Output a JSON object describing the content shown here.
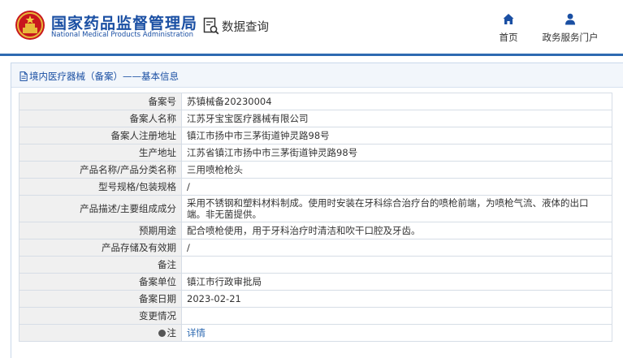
{
  "header": {
    "title": "国家药品监督管理局",
    "subtitle": "National Medical Products Administration",
    "data_query": "数据查询",
    "nav": [
      {
        "label": "首页",
        "icon": "home-icon"
      },
      {
        "label": "政务服务门户",
        "icon": "user-icon"
      }
    ]
  },
  "breadcrumb": {
    "text": "境内医疗器械（备案）——基本信息",
    "icon": "document-icon"
  },
  "colors": {
    "brand_blue": "#1a4fa3",
    "bar_blue": "#2e6ab1",
    "label_bg": "#f0f0f0",
    "panel_head_bg": "#f2f6fb"
  },
  "details": {
    "record_no": {
      "label": "备案号",
      "value": "苏镇械备20230004"
    },
    "registrant": {
      "label": "备案人名称",
      "value": "江苏牙宝宝医疗器械有限公司"
    },
    "registrant_address": {
      "label": "备案人注册地址",
      "value": "镇江市扬中市三茅街道钟灵路98号"
    },
    "production_address": {
      "label": "生产地址",
      "value": "江苏省镇江市扬中市三茅街道钟灵路98号"
    },
    "product_name": {
      "label": "产品名称/产品分类名称",
      "value": "三用喷枪枪头"
    },
    "model_spec": {
      "label": "型号规格/包装规格",
      "value": "/"
    },
    "description": {
      "label": "产品描述/主要组成成分",
      "value": "采用不锈钢和塑料材料制成。使用时安装在牙科综合治疗台的喷枪前端，为喷枪气流、液体的出口端。非无菌提供。"
    },
    "intended_use": {
      "label": "预期用途",
      "value": "配合喷枪使用，用于牙科治疗时清洁和吹干口腔及牙齿。"
    },
    "storage": {
      "label": "产品存储及有效期",
      "value": "/"
    },
    "remarks": {
      "label": "备注",
      "value": ""
    },
    "authority": {
      "label": "备案单位",
      "value": "镇江市行政审批局"
    },
    "record_date": {
      "label": "备案日期",
      "value": "2023-02-21"
    },
    "changes": {
      "label": "变更情况",
      "value": ""
    },
    "note": {
      "label": "注",
      "value": "详情",
      "icon": "info-dot-icon"
    }
  }
}
